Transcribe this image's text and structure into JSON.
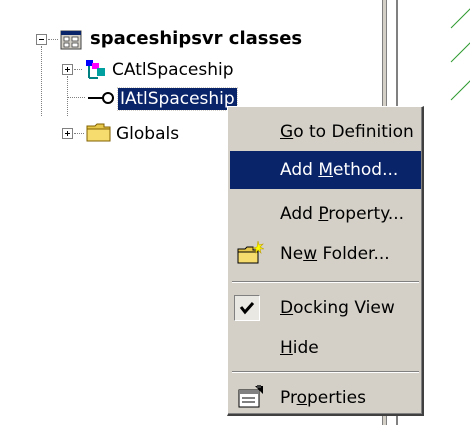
{
  "tree": {
    "root_label": "spaceshipsvr classes",
    "items": [
      {
        "label": "CAtlSpaceship",
        "expander": "plus"
      },
      {
        "label": "IAtlSpaceship",
        "selected": true
      },
      {
        "label": "Globals",
        "expander": "plus"
      }
    ]
  },
  "context_menu": {
    "items": [
      {
        "pre": "",
        "u": "G",
        "post": "o to Definition"
      },
      {
        "pre": "Add ",
        "u": "M",
        "post": "ethod..."
      },
      {
        "pre": "Add ",
        "u": "P",
        "post": "roperty..."
      },
      {
        "pre": "Ne",
        "u": "w",
        "post": " Folder..."
      },
      {
        "pre": "",
        "u": "D",
        "post": "ocking View"
      },
      {
        "pre": "",
        "u": "H",
        "post": "ide"
      },
      {
        "pre": "Pr",
        "u": "o",
        "post": "perties"
      }
    ],
    "checked_item": "Docking View",
    "highlighted_item": "Add Method...",
    "icons": {
      "new_folder": "new-folder-icon",
      "docking_view": "checkmark-icon",
      "properties": "properties-icon"
    }
  },
  "colors": {
    "selection": "#0a246a",
    "menu_bg": "#d4d0c8",
    "folder": "#e8c84a"
  }
}
